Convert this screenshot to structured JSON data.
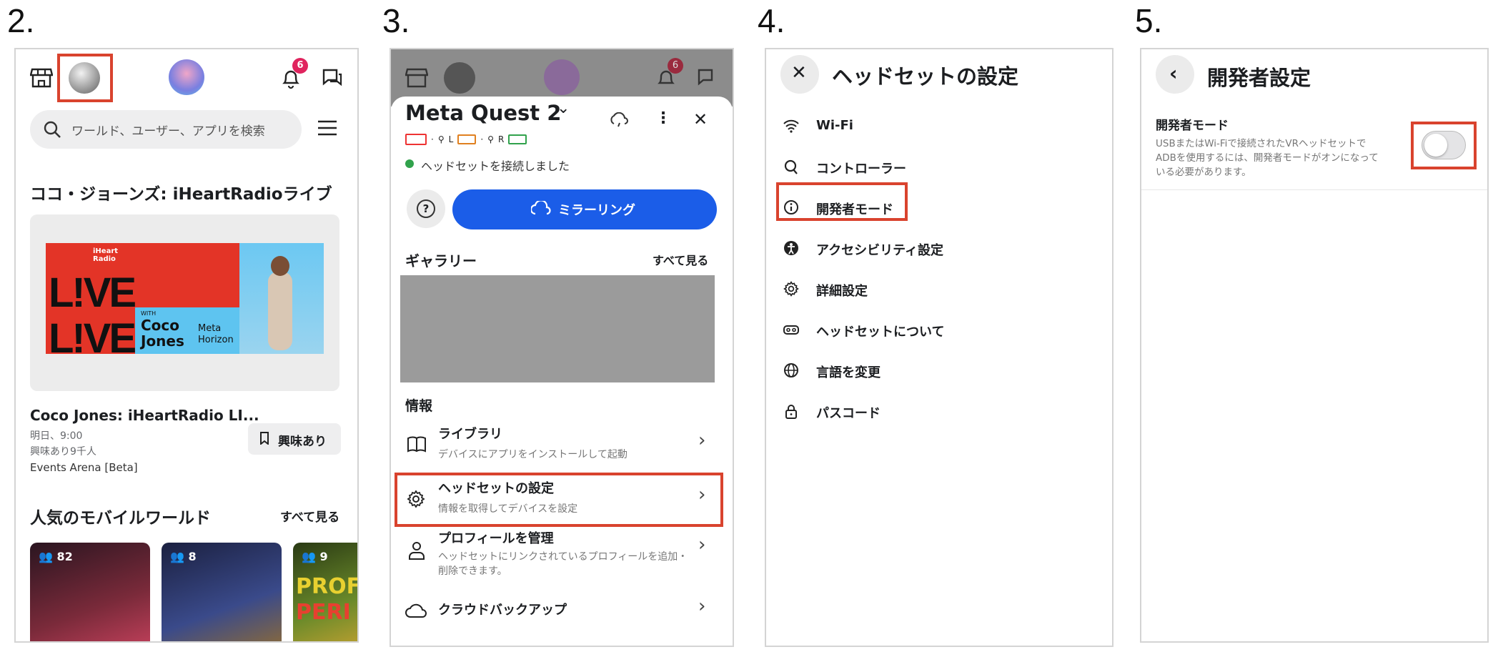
{
  "steps": [
    "2.",
    "3.",
    "4.",
    "5."
  ],
  "panel2": {
    "notif_badge": "6",
    "search_placeholder": "ワールド、ユーザー、アプリを検索",
    "featured_title": "ココ・ジョーンズ: iHeartRadioライブ",
    "poster": {
      "logo": "iHeart Radio",
      "live": "L!VE",
      "with": "WITH",
      "name1": "Coco",
      "name2": "Jones",
      "brand1": "Meta",
      "brand2": "Horizon"
    },
    "event_title": "Coco Jones: iHeartRadio LI...",
    "event_time": "明日、9:00",
    "event_interest": "興味あり9千人",
    "event_location": "Events Arena [Beta]",
    "interest_button": "興味あり",
    "popular_title": "人気のモバイルワールド",
    "see_all": "すべて見る",
    "thumbs": [
      {
        "count": "82",
        "color": "#3b1d2a"
      },
      {
        "count": "8",
        "color": "#2d3358"
      },
      {
        "count": "9",
        "color": "#4f6a24"
      }
    ],
    "thumb3_text": [
      "PROF",
      "PERI"
    ]
  },
  "panel3": {
    "notif_badge": "6",
    "device_name": "Meta Quest 2",
    "battery_labels": [
      "L",
      "R"
    ],
    "connected_text": "ヘッドセットを接続しました",
    "mirror_button": "ミラーリング",
    "gallery_title": "ギャラリー",
    "gallery_see_all": "すべて見る",
    "info_title": "情報",
    "menu": [
      {
        "title": "ライブラリ",
        "subtitle": "デバイスにアプリをインストールして起動",
        "icon": "book-icon"
      },
      {
        "title": "ヘッドセットの設定",
        "subtitle": "情報を取得してデバイスを設定",
        "icon": "gear-icon"
      },
      {
        "title": "プロフィールを管理",
        "subtitle": "ヘッドセットにリンクされているプロフィールを追加・削除できます。",
        "icon": "person-icon"
      },
      {
        "title": "クラウドバックアップ",
        "subtitle": "",
        "icon": "cloud-icon"
      }
    ]
  },
  "panel4": {
    "title": "ヘッドセットの設定",
    "items": [
      {
        "label": "Wi-Fi",
        "icon": "wifi-icon"
      },
      {
        "label": "コントローラー",
        "icon": "controller-icon"
      },
      {
        "label": "開発者モード",
        "icon": "info-icon"
      },
      {
        "label": "アクセシビリティ設定",
        "icon": "accessibility-icon"
      },
      {
        "label": "詳細設定",
        "icon": "gear-icon"
      },
      {
        "label": "ヘッドセットについて",
        "icon": "headset-icon"
      },
      {
        "label": "言語を変更",
        "icon": "globe-icon"
      },
      {
        "label": "パスコード",
        "icon": "lock-icon"
      }
    ]
  },
  "panel5": {
    "title": "開発者設定",
    "dev_mode_label": "開発者モード",
    "dev_mode_desc1": "USBまたはWi-Fiで接続されたVRヘッドセットで",
    "dev_mode_desc2": "ADBを使用するには、開発者モードがオンになって",
    "dev_mode_desc3": "いる必要があります。",
    "toggle_state": "off"
  },
  "colors": {
    "highlight": "#d9432e",
    "accent": "#1b5de8",
    "badge": "#e0245e",
    "connected": "#31a24c"
  }
}
